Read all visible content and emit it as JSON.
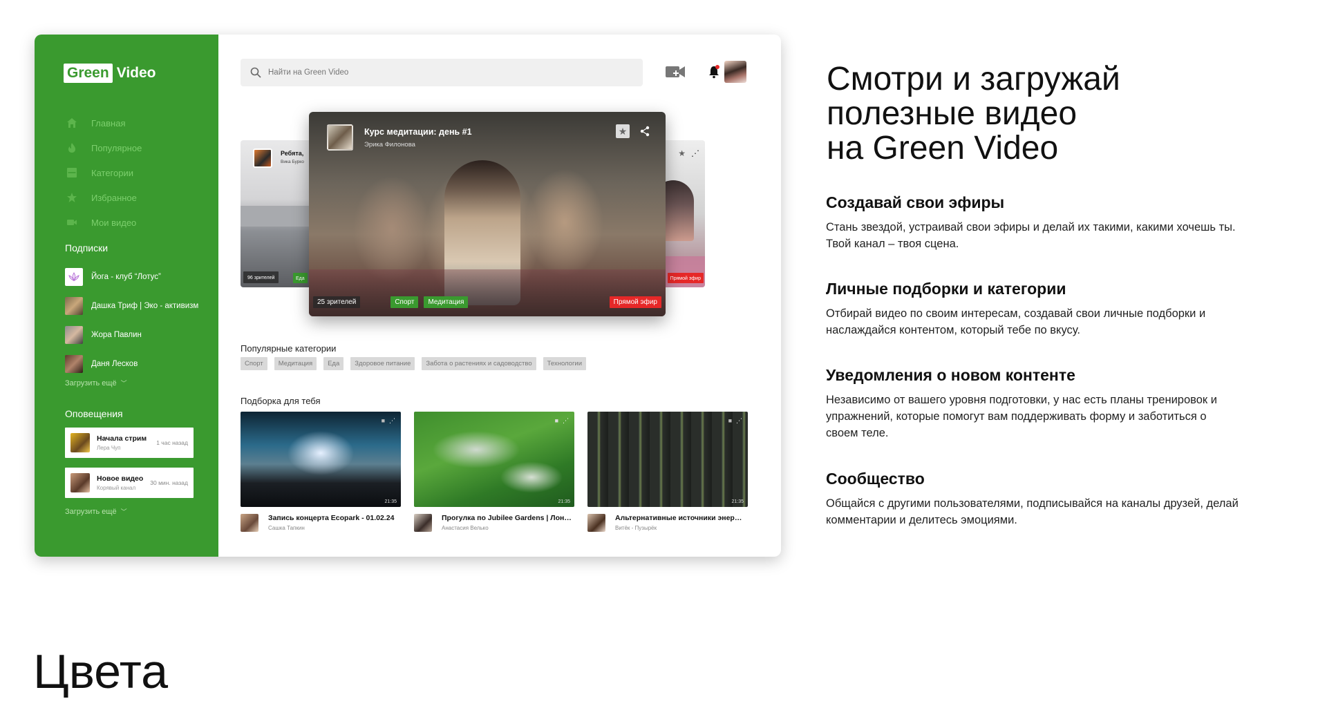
{
  "app": {
    "logo_box": "Green",
    "logo_text": "Video",
    "nav": [
      {
        "label": "Главная",
        "icon": "home-icon"
      },
      {
        "label": "Популярное",
        "icon": "flame-icon"
      },
      {
        "label": "Категории",
        "icon": "grid-icon"
      },
      {
        "label": "Избранное",
        "icon": "star-icon"
      },
      {
        "label": "Мои видео",
        "icon": "video-icon"
      }
    ],
    "subscriptions_title": "Подписки",
    "subscriptions": [
      {
        "name": "Йога - клуб “Лотус”"
      },
      {
        "name": "Дашка Триф | Эко - активизм"
      },
      {
        "name": "Жора Павлин"
      },
      {
        "name": "Даня Лесков"
      }
    ],
    "load_more": "Загрузить ещё",
    "notifications_title": "Оповещения",
    "notifications": [
      {
        "title": "Начала стрим",
        "sub": "Лера Чуп",
        "time": "1 час назад"
      },
      {
        "title": "Новое видео",
        "sub": "Корявый канал",
        "time": "30 мин. назад"
      }
    ],
    "search_placeholder": "Найти на Green Video",
    "featured": {
      "title": "Курс медитации: день #1",
      "author": "Эрика Филонова",
      "viewers": "25 зрителей",
      "tags": [
        "Спорт",
        "Медитация"
      ],
      "live": "Прямой эфир"
    },
    "left_card": {
      "title": "Ребята,",
      "author": "Вика Бурко",
      "viewers": "96 зрителей",
      "tag": "Еда"
    },
    "right_card": {
      "live": "Прямой эфир"
    },
    "popular_title": "Популярные категории",
    "categories": [
      "Спорт",
      "Медитация",
      "Еда",
      "Здоровое питание",
      "Забота о растениях и садоводство",
      "Технологии"
    ],
    "recommend_title": "Подборка для тебя",
    "recommendations": [
      {
        "title": "Запись концерта Ecopark - 01.02.24",
        "author": "Сашка Тапкин",
        "duration": "21:35"
      },
      {
        "title": "Прогулка по Jubilee Gardens | Лон…",
        "author": "Анастасия Велько",
        "duration": "21:35"
      },
      {
        "title": "Альтернативные источники энер…",
        "author": "Витёк - Пузырёк",
        "duration": "21:35"
      }
    ],
    "colors": {
      "brand": "#3a9a2f",
      "live": "#e62828"
    }
  },
  "marketing": {
    "hero": [
      "Смотри и загружай",
      "полезные видео",
      "на Green Video"
    ],
    "features": [
      {
        "title": "Создавай свои эфиры",
        "text": "Стань звездой, устраивай свои эфиры и делай их такими, какими хочешь ты. Твой канал – твоя сцена."
      },
      {
        "title": "Личные подборки и категории",
        "text": "Отбирай видео по своим интересам, создавай свои личные подборки и наслаждайся контентом, который тебе по вкусу."
      },
      {
        "title": "Уведомления о новом контенте",
        "text": "Независимо от вашего уровня подготовки, у нас есть планы тренировок и упражнений, которые помогут вам поддерживать форму и заботиться о своем теле."
      },
      {
        "title": "Сообщество",
        "text": " Общайся с другими пользователями, подписывайся на каналы друзей, делай комментарии и делитесь эмоциями."
      }
    ],
    "colors_title": "Цвета"
  }
}
